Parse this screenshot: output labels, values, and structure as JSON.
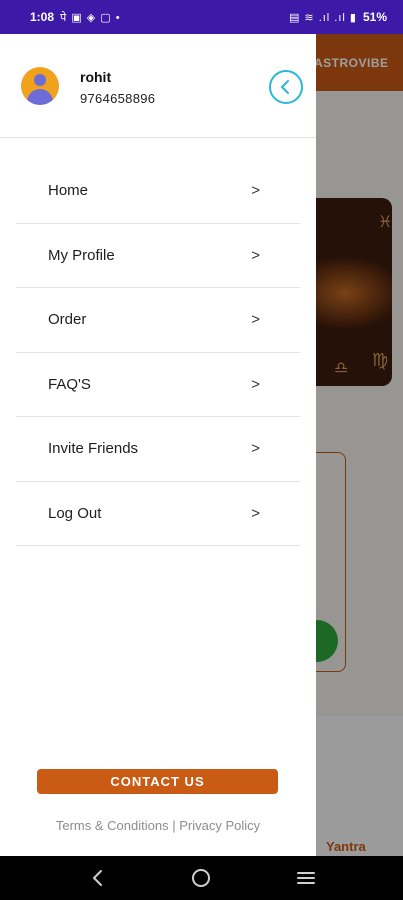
{
  "status_bar": {
    "time": "1:08",
    "left_icons": "पे ▣ ◈ ▢ •",
    "right_icons": "▤ ≋ .ıl .ıl ▮",
    "battery": "51%"
  },
  "background_app": {
    "brand": "ASTROVIBE",
    "product_label": "Yantra",
    "brand_color": "#c95b14"
  },
  "drawer": {
    "user": {
      "name": "rohit",
      "phone": "9764658896"
    },
    "menu": [
      {
        "label": "Home",
        "icon": "chevron-right-icon"
      },
      {
        "label": "My Profile",
        "icon": "chevron-right-icon"
      },
      {
        "label": "Order",
        "icon": "chevron-right-icon"
      },
      {
        "label": "FAQ'S",
        "icon": "chevron-right-icon"
      },
      {
        "label": "Invite Friends",
        "icon": "chevron-right-icon"
      },
      {
        "label": "Log Out",
        "icon": "chevron-right-icon"
      }
    ],
    "chevron": ">",
    "contact_button": "CONTACT US",
    "terms": "Terms & Conditions",
    "separator": "|",
    "privacy": "Privacy Policy"
  },
  "colors": {
    "accent": "#c95b14",
    "close_ring": "#28b8d8",
    "status_bar": "#3d19a8"
  }
}
